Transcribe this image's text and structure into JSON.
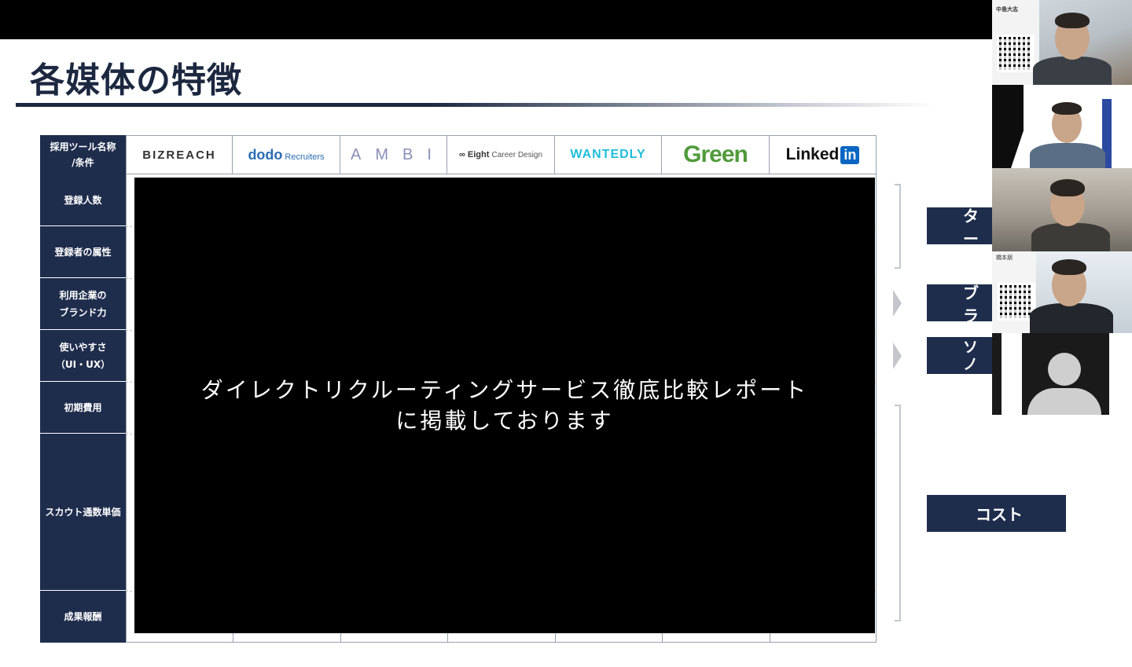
{
  "slide": {
    "title": "各媒体の特徴"
  },
  "table": {
    "header_label_line1": "採用ツール名称",
    "header_label_line2": "/条件",
    "logos": {
      "bizreach": "BIZREACH",
      "dodo": "dodo",
      "dodo_sub": "Recruiters",
      "ambi": "AMBI",
      "eight": "∞ Eight",
      "eight_sub": "Career Design",
      "wantedly": "WANTEDLY",
      "green": "Green",
      "linkedin": "Linked",
      "linkedin_in": "in"
    },
    "rows": [
      {
        "line1": "登録人数",
        "line2": ""
      },
      {
        "line1": "登録者の属性",
        "line2": ""
      },
      {
        "line1": "利用企業の",
        "line2": "ブランド力"
      },
      {
        "line1": "使いやすさ",
        "line2": "（UI・UX）"
      },
      {
        "line1": "初期費用",
        "line2": ""
      },
      {
        "line1": "スカウト通数単価",
        "line2": ""
      },
      {
        "line1": "成果報酬",
        "line2": ""
      }
    ]
  },
  "overlay": {
    "line1": "ダイレクトリクルーティングサービス徹底比較レポート",
    "line2": "に掲載しております"
  },
  "right_panel": {
    "btn1": "ター",
    "btn2": "ブラ",
    "btn3_line1": "リソ",
    "btn3_line2": "ノウ",
    "btn4": "コスト"
  },
  "video": {
    "tile1_name": "中島大志",
    "tile4_name": "橋本朋"
  }
}
